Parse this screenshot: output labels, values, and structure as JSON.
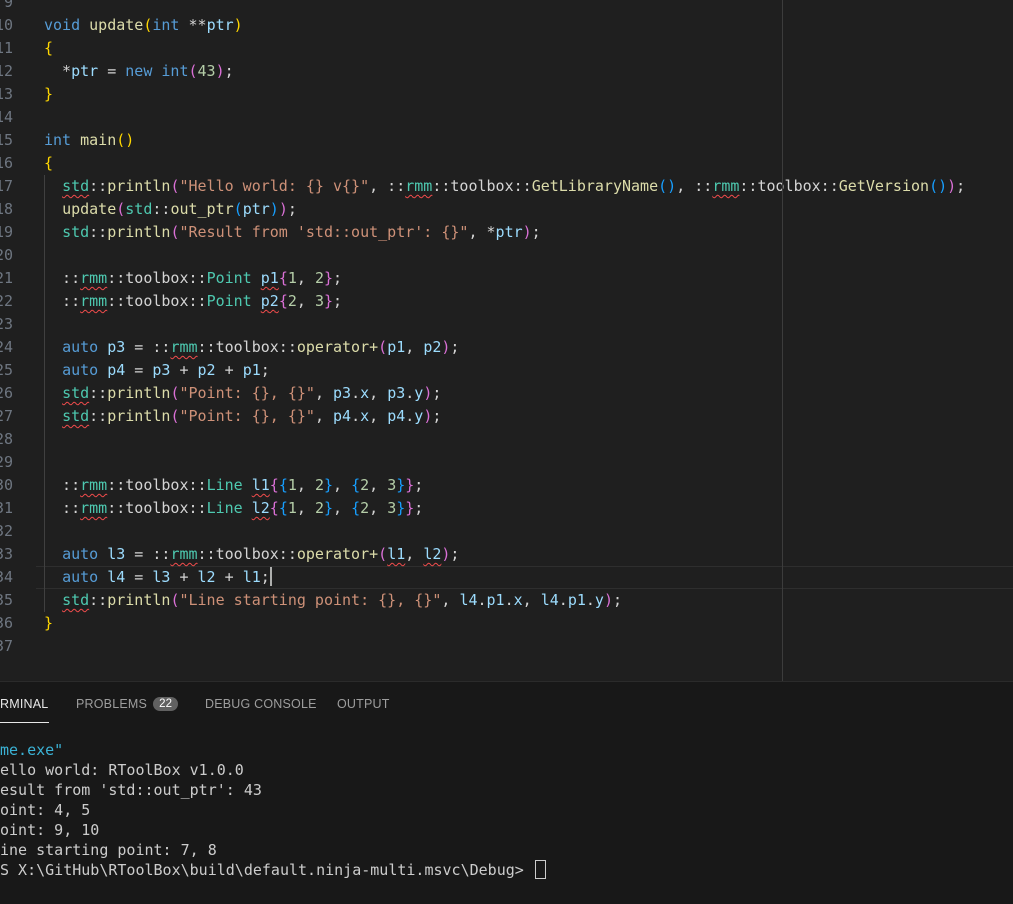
{
  "editor": {
    "line_numbers": [
      "9",
      "10",
      "11",
      "12",
      "13",
      "14",
      "15",
      "16",
      "17",
      "18",
      "19",
      "20",
      "21",
      "22",
      "23",
      "24",
      "25",
      "26",
      "27",
      "28",
      "29",
      "30",
      "31",
      "32",
      "33",
      "34",
      "35",
      "36",
      "37"
    ],
    "lines": [
      [],
      [
        {
          "t": "void",
          "c": "kw"
        },
        {
          "t": " "
        },
        {
          "t": "update",
          "c": "fn"
        },
        {
          "t": "(",
          "c": "b1"
        },
        {
          "t": "int",
          "c": "kw"
        },
        {
          "t": " **"
        },
        {
          "t": "ptr",
          "c": "id"
        },
        {
          "t": ")",
          "c": "b1"
        }
      ],
      [
        {
          "t": "{",
          "c": "b1"
        }
      ],
      [
        {
          "t": "  *"
        },
        {
          "t": "ptr",
          "c": "id"
        },
        {
          "t": " = "
        },
        {
          "t": "new",
          "c": "kw"
        },
        {
          "t": " "
        },
        {
          "t": "int",
          "c": "kw"
        },
        {
          "t": "(",
          "c": "b2"
        },
        {
          "t": "43",
          "c": "num"
        },
        {
          "t": ")",
          "c": "b2"
        },
        {
          "t": ";"
        }
      ],
      [
        {
          "t": "}",
          "c": "b1"
        }
      ],
      [],
      [
        {
          "t": "int",
          "c": "kw"
        },
        {
          "t": " "
        },
        {
          "t": "main",
          "c": "fn"
        },
        {
          "t": "()",
          "c": "b1"
        }
      ],
      [
        {
          "t": "{",
          "c": "b1"
        }
      ],
      [
        {
          "t": "  "
        },
        {
          "t": "std",
          "c": "ty",
          "sq": true
        },
        {
          "t": "::"
        },
        {
          "t": "println",
          "c": "fn"
        },
        {
          "t": "(",
          "c": "b2"
        },
        {
          "t": "\"Hello world: {} v{}\"",
          "c": "str"
        },
        {
          "t": ", ::"
        },
        {
          "t": "rmm",
          "c": "ty",
          "sq": true
        },
        {
          "t": "::toolbox::"
        },
        {
          "t": "GetLibraryName",
          "c": "fn"
        },
        {
          "t": "()",
          "c": "b3"
        },
        {
          "t": ", ::"
        },
        {
          "t": "rmm",
          "c": "ty",
          "sq": true
        },
        {
          "t": "::toolbox::"
        },
        {
          "t": "GetVersion",
          "c": "fn"
        },
        {
          "t": "()",
          "c": "b3"
        },
        {
          "t": ")",
          "c": "b2"
        },
        {
          "t": ";"
        }
      ],
      [
        {
          "t": "  "
        },
        {
          "t": "update",
          "c": "fn"
        },
        {
          "t": "(",
          "c": "b2"
        },
        {
          "t": "std",
          "c": "ty"
        },
        {
          "t": "::"
        },
        {
          "t": "out_ptr",
          "c": "fn"
        },
        {
          "t": "(",
          "c": "b3"
        },
        {
          "t": "ptr",
          "c": "id"
        },
        {
          "t": ")",
          "c": "b3"
        },
        {
          "t": ")",
          "c": "b2"
        },
        {
          "t": ";"
        }
      ],
      [
        {
          "t": "  "
        },
        {
          "t": "std",
          "c": "ty"
        },
        {
          "t": "::"
        },
        {
          "t": "println",
          "c": "fn"
        },
        {
          "t": "(",
          "c": "b2"
        },
        {
          "t": "\"Result from 'std::out_ptr': {}\"",
          "c": "str"
        },
        {
          "t": ", *"
        },
        {
          "t": "ptr",
          "c": "id"
        },
        {
          "t": ")",
          "c": "b2"
        },
        {
          "t": ";"
        }
      ],
      [],
      [
        {
          "t": "  ::"
        },
        {
          "t": "rmm",
          "c": "ty",
          "sq": true
        },
        {
          "t": "::toolbox::"
        },
        {
          "t": "Point",
          "c": "ty"
        },
        {
          "t": " "
        },
        {
          "t": "p1",
          "c": "var",
          "sq": true
        },
        {
          "t": "{",
          "c": "b2"
        },
        {
          "t": "1",
          "c": "num"
        },
        {
          "t": ", "
        },
        {
          "t": "2",
          "c": "num"
        },
        {
          "t": "}",
          "c": "b2"
        },
        {
          "t": ";"
        }
      ],
      [
        {
          "t": "  ::"
        },
        {
          "t": "rmm",
          "c": "ty",
          "sq": true
        },
        {
          "t": "::toolbox::"
        },
        {
          "t": "Point",
          "c": "ty"
        },
        {
          "t": " "
        },
        {
          "t": "p2",
          "c": "var",
          "sq": true
        },
        {
          "t": "{",
          "c": "b2"
        },
        {
          "t": "2",
          "c": "num"
        },
        {
          "t": ", "
        },
        {
          "t": "3",
          "c": "num"
        },
        {
          "t": "}",
          "c": "b2"
        },
        {
          "t": ";"
        }
      ],
      [],
      [
        {
          "t": "  "
        },
        {
          "t": "auto",
          "c": "kw"
        },
        {
          "t": " "
        },
        {
          "t": "p3",
          "c": "var"
        },
        {
          "t": " = ::"
        },
        {
          "t": "rmm",
          "c": "ty",
          "sq": true
        },
        {
          "t": "::toolbox::"
        },
        {
          "t": "operator+",
          "c": "fn"
        },
        {
          "t": "(",
          "c": "b2"
        },
        {
          "t": "p1",
          "c": "var"
        },
        {
          "t": ", "
        },
        {
          "t": "p2",
          "c": "var"
        },
        {
          "t": ")",
          "c": "b2"
        },
        {
          "t": ";"
        }
      ],
      [
        {
          "t": "  "
        },
        {
          "t": "auto",
          "c": "kw"
        },
        {
          "t": " "
        },
        {
          "t": "p4",
          "c": "var"
        },
        {
          "t": " = "
        },
        {
          "t": "p3",
          "c": "var"
        },
        {
          "t": " + "
        },
        {
          "t": "p2",
          "c": "var"
        },
        {
          "t": " + "
        },
        {
          "t": "p1",
          "c": "var"
        },
        {
          "t": ";"
        }
      ],
      [
        {
          "t": "  "
        },
        {
          "t": "std",
          "c": "ty",
          "sq": true
        },
        {
          "t": "::"
        },
        {
          "t": "println",
          "c": "fn"
        },
        {
          "t": "(",
          "c": "b2"
        },
        {
          "t": "\"Point: {}, {}\"",
          "c": "str"
        },
        {
          "t": ", "
        },
        {
          "t": "p3",
          "c": "var"
        },
        {
          "t": "."
        },
        {
          "t": "x",
          "c": "var"
        },
        {
          "t": ", "
        },
        {
          "t": "p3",
          "c": "var"
        },
        {
          "t": "."
        },
        {
          "t": "y",
          "c": "var"
        },
        {
          "t": ")",
          "c": "b2"
        },
        {
          "t": ";"
        }
      ],
      [
        {
          "t": "  "
        },
        {
          "t": "std",
          "c": "ty",
          "sq": true
        },
        {
          "t": "::"
        },
        {
          "t": "println",
          "c": "fn"
        },
        {
          "t": "(",
          "c": "b2"
        },
        {
          "t": "\"Point: {}, {}\"",
          "c": "str"
        },
        {
          "t": ", "
        },
        {
          "t": "p4",
          "c": "var"
        },
        {
          "t": "."
        },
        {
          "t": "x",
          "c": "var"
        },
        {
          "t": ", "
        },
        {
          "t": "p4",
          "c": "var"
        },
        {
          "t": "."
        },
        {
          "t": "y",
          "c": "var"
        },
        {
          "t": ")",
          "c": "b2"
        },
        {
          "t": ";"
        }
      ],
      [],
      [],
      [
        {
          "t": "  ::"
        },
        {
          "t": "rmm",
          "c": "ty",
          "sq": true
        },
        {
          "t": "::toolbox::"
        },
        {
          "t": "Line",
          "c": "ty"
        },
        {
          "t": " "
        },
        {
          "t": "l1",
          "c": "var",
          "sq": true
        },
        {
          "t": "{",
          "c": "b2"
        },
        {
          "t": "{",
          "c": "b3"
        },
        {
          "t": "1",
          "c": "num"
        },
        {
          "t": ", "
        },
        {
          "t": "2",
          "c": "num"
        },
        {
          "t": "}",
          "c": "b3"
        },
        {
          "t": ", "
        },
        {
          "t": "{",
          "c": "b3"
        },
        {
          "t": "2",
          "c": "num"
        },
        {
          "t": ", "
        },
        {
          "t": "3",
          "c": "num"
        },
        {
          "t": "}",
          "c": "b3"
        },
        {
          "t": "}",
          "c": "b2"
        },
        {
          "t": ";"
        }
      ],
      [
        {
          "t": "  ::"
        },
        {
          "t": "rmm",
          "c": "ty",
          "sq": true
        },
        {
          "t": "::toolbox::"
        },
        {
          "t": "Line",
          "c": "ty"
        },
        {
          "t": " "
        },
        {
          "t": "l2",
          "c": "var",
          "sq": true
        },
        {
          "t": "{",
          "c": "b2"
        },
        {
          "t": "{",
          "c": "b3"
        },
        {
          "t": "1",
          "c": "num"
        },
        {
          "t": ", "
        },
        {
          "t": "2",
          "c": "num"
        },
        {
          "t": "}",
          "c": "b3"
        },
        {
          "t": ", "
        },
        {
          "t": "{",
          "c": "b3"
        },
        {
          "t": "2",
          "c": "num"
        },
        {
          "t": ", "
        },
        {
          "t": "3",
          "c": "num"
        },
        {
          "t": "}",
          "c": "b3"
        },
        {
          "t": "}",
          "c": "b2"
        },
        {
          "t": ";"
        }
      ],
      [],
      [
        {
          "t": "  "
        },
        {
          "t": "auto",
          "c": "kw"
        },
        {
          "t": " "
        },
        {
          "t": "l3",
          "c": "var"
        },
        {
          "t": " = ::"
        },
        {
          "t": "rmm",
          "c": "ty",
          "sq": true
        },
        {
          "t": "::toolbox::"
        },
        {
          "t": "operator+",
          "c": "fn"
        },
        {
          "t": "(",
          "c": "b2"
        },
        {
          "t": "l1",
          "c": "var",
          "sq": true
        },
        {
          "t": ", "
        },
        {
          "t": "l2",
          "c": "var",
          "sq": true
        },
        {
          "t": ")",
          "c": "b2"
        },
        {
          "t": ";"
        }
      ],
      [
        {
          "t": "  "
        },
        {
          "t": "auto",
          "c": "kw"
        },
        {
          "t": " "
        },
        {
          "t": "l4",
          "c": "var"
        },
        {
          "t": " = "
        },
        {
          "t": "l3",
          "c": "var"
        },
        {
          "t": " + "
        },
        {
          "t": "l2",
          "c": "var"
        },
        {
          "t": " + "
        },
        {
          "t": "l1",
          "c": "var"
        },
        {
          "t": ";"
        },
        {
          "cursor": true
        }
      ],
      [
        {
          "t": "  "
        },
        {
          "t": "std",
          "c": "ty",
          "sq": true
        },
        {
          "t": "::"
        },
        {
          "t": "println",
          "c": "fn"
        },
        {
          "t": "(",
          "c": "b2"
        },
        {
          "t": "\"Line starting point: {}, {}\"",
          "c": "str"
        },
        {
          "t": ", "
        },
        {
          "t": "l4",
          "c": "var"
        },
        {
          "t": "."
        },
        {
          "t": "p1",
          "c": "var"
        },
        {
          "t": "."
        },
        {
          "t": "x",
          "c": "var"
        },
        {
          "t": ", "
        },
        {
          "t": "l4",
          "c": "var"
        },
        {
          "t": "."
        },
        {
          "t": "p1",
          "c": "var"
        },
        {
          "t": "."
        },
        {
          "t": "y",
          "c": "var"
        },
        {
          "t": ")",
          "c": "b2"
        },
        {
          "t": ";"
        }
      ],
      [
        {
          "t": "}",
          "c": "b1"
        }
      ],
      []
    ]
  },
  "panel": {
    "tabs": {
      "terminal": "RMINAL",
      "problems": "PROBLEMS",
      "problems_count": "22",
      "debug_console": "DEBUG CONSOLE",
      "output": "OUTPUT"
    },
    "terminal_lines": [
      "me.exe\"",
      "ello world: RToolBox v1.0.0",
      "esult from 'std::out_ptr': 43",
      "oint: 4, 5",
      "oint: 9, 10",
      "ine starting point: 7, 8",
      "S X:\\GitHub\\RToolBox\\build\\default.ninja-multi.msvc\\Debug> "
    ]
  }
}
